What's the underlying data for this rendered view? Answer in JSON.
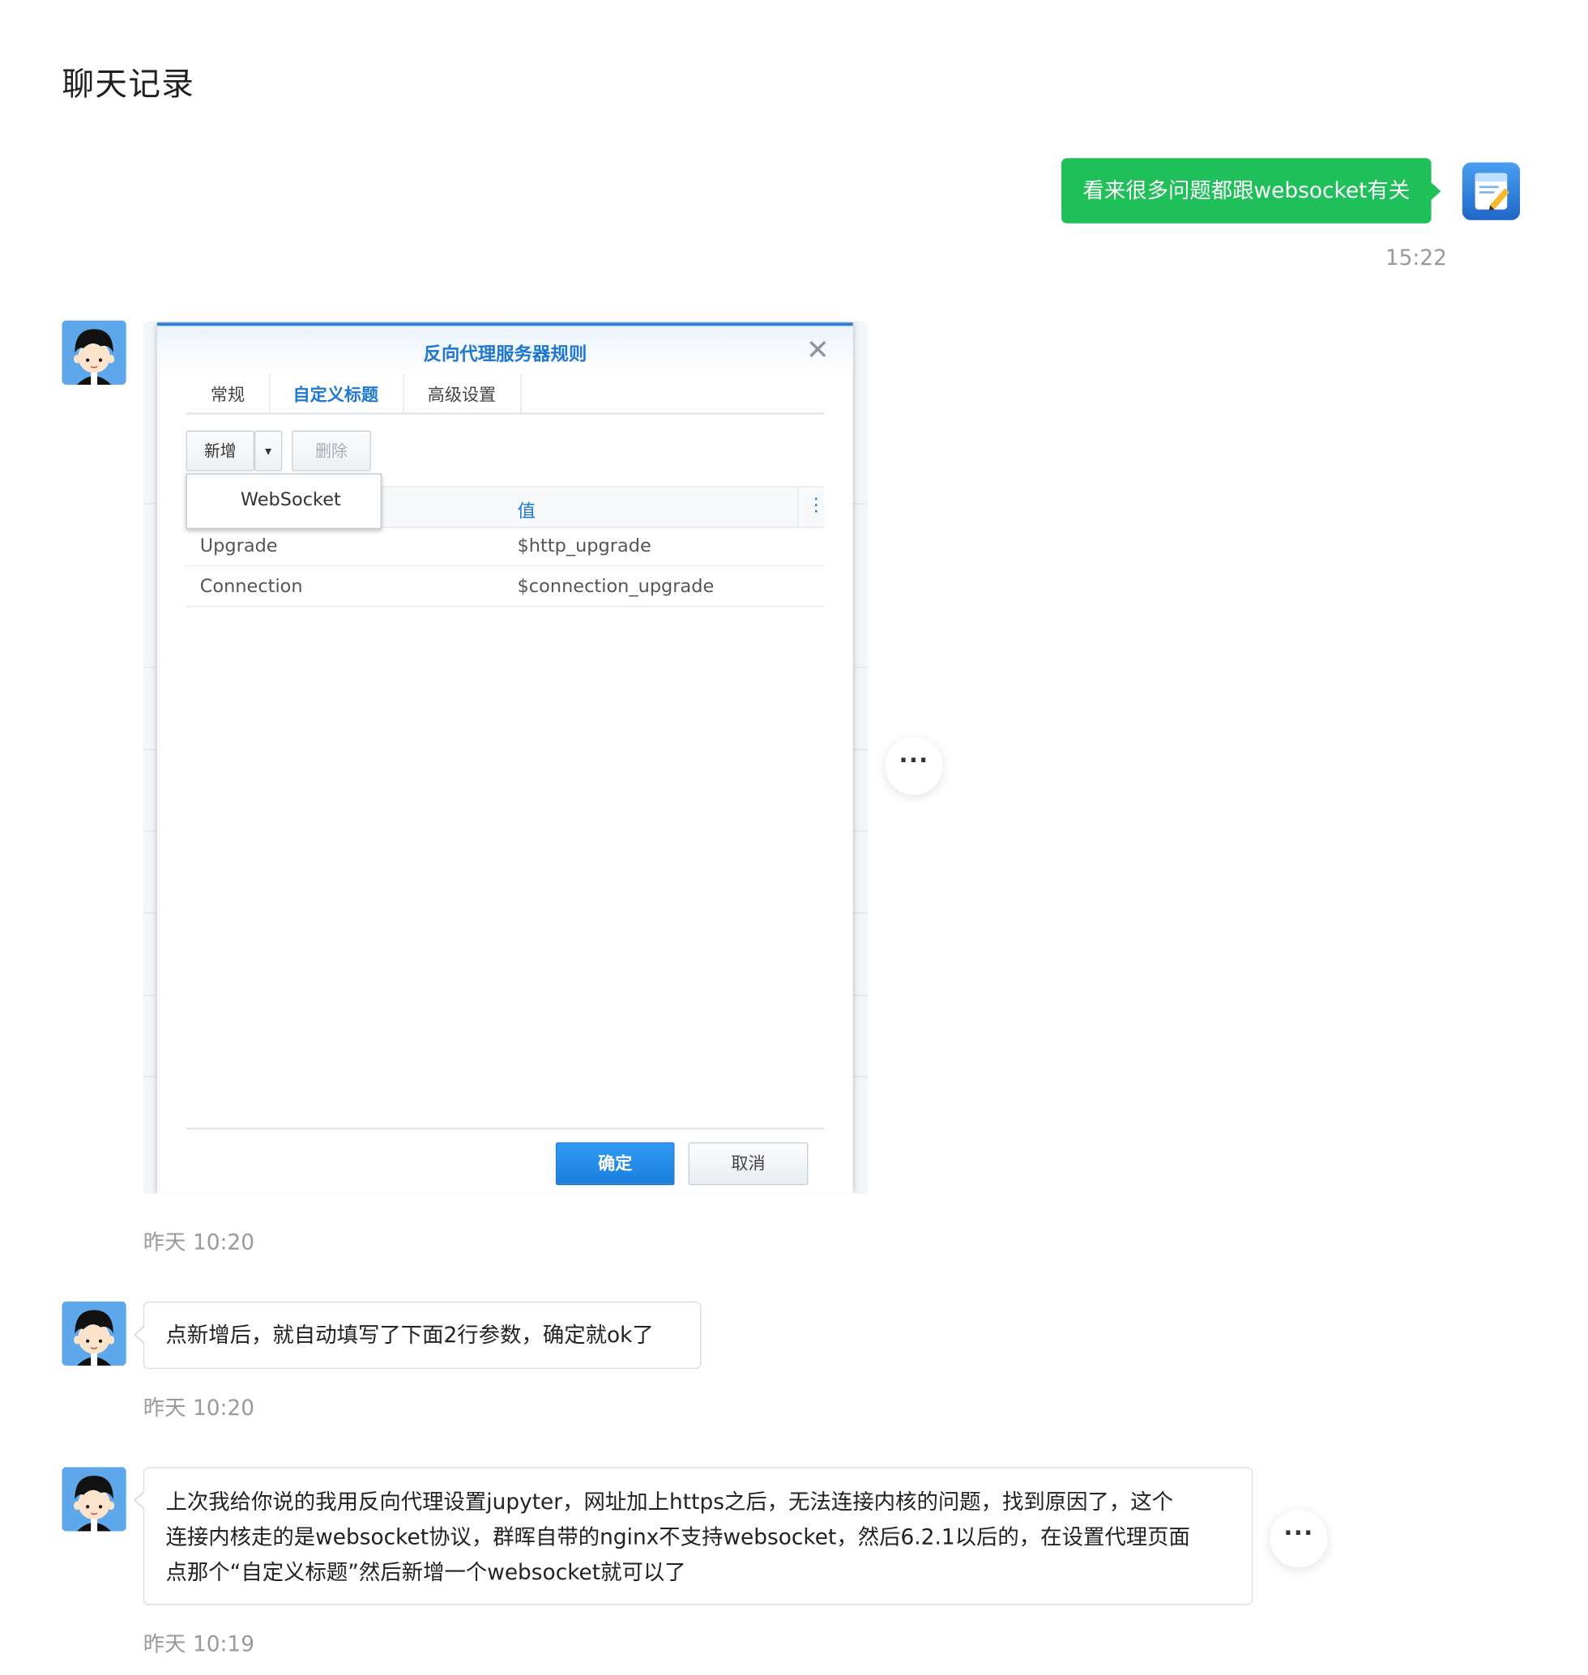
{
  "page": {
    "title": "聊天记录"
  },
  "messages": [
    {
      "text": "看来很多问题都跟websocket有关",
      "time": "15:22"
    },
    {
      "image": {
        "dialog_title": "反向代理服务器规则",
        "close_icon": "✕",
        "tabs": [
          "常规",
          "自定义标题",
          "高级设置"
        ],
        "toolbar": {
          "add_label": "新增",
          "caret": "▾",
          "delete_label": "删除"
        },
        "dropdown_item": "WebSocket",
        "column_value": "值",
        "column_menu": "⋮",
        "rows": [
          {
            "name": "Upgrade",
            "value": "$http_upgrade"
          },
          {
            "name": "Connection",
            "value": "$connection_upgrade"
          }
        ],
        "ok_label": "确定",
        "cancel_label": "取消"
      },
      "time": "昨天 10:20",
      "more": "···"
    },
    {
      "text": "点新增后，就自动填写了下面2行参数，确定就ok了",
      "time": "昨天 10:20"
    },
    {
      "lines": [
        "上次我给你说的我用反向代理设置jupyter，网址加上https之后，无法连接内核的问题，找到原因了，这个",
        "连接内核走的是websocket协议，群晖自带的nginx不支持websocket，然后6.2.1以后的，在设置代理页面",
        "点那个“自定义标题”然后新增一个websocket就可以了"
      ],
      "time": "昨天 10:19",
      "more": "···"
    }
  ],
  "colors": {
    "green_bubble": "#1fc05a",
    "accent_blue": "#1f78d1",
    "timestamp": "#9a9a9a"
  }
}
